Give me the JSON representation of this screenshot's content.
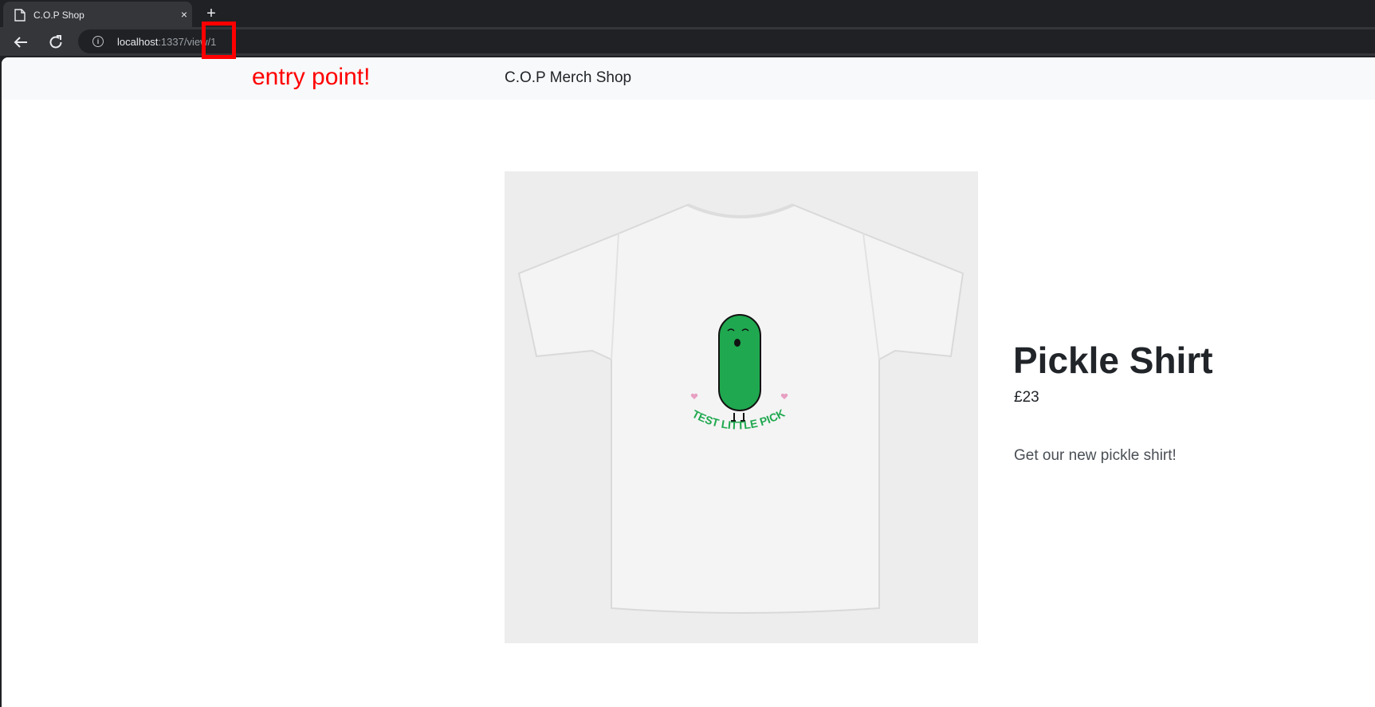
{
  "browser": {
    "tab_title": "C.O.P Shop",
    "tab_close": "×",
    "new_tab": "+",
    "url_host": "localhost",
    "url_path": ":1337/view/1",
    "info_glyph": "i"
  },
  "navbar": {
    "brand": "C.O.P Merch Shop"
  },
  "product": {
    "image_caption": "CUTEST LITTLE PICKLE",
    "title": "Pickle Shirt",
    "price": "£23",
    "description": "Get our new pickle shirt!"
  },
  "annotation": {
    "label": "entry point!",
    "color": "#ff0000"
  },
  "colors": {
    "chrome_bg": "#202124",
    "tab_bg": "#35363a",
    "navbar_bg": "#f8f9fa",
    "pickle_green": "#1fa84f"
  }
}
